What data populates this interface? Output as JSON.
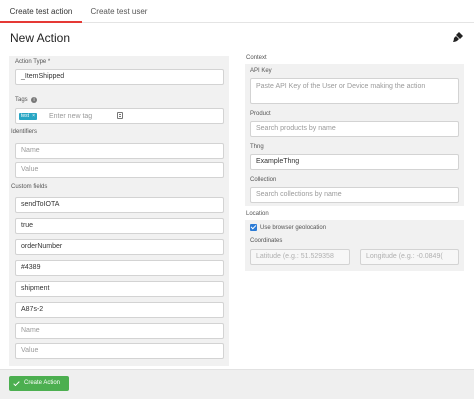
{
  "tabs": [
    {
      "label": "Create test action",
      "active": true
    },
    {
      "label": "Create test user",
      "active": false
    }
  ],
  "page_title": "New Action",
  "icons": {
    "clear": "paint-brush-icon",
    "info": "info-icon",
    "keyboard": "keyboard-icon",
    "check": "check-icon"
  },
  "colors": {
    "tab_active": "#e53935",
    "tag": "#28a6c4",
    "checkbox": "#2b7bd6",
    "button": "#4caf50"
  },
  "left": {
    "action_type": {
      "label": "Action Type *",
      "value": "_ItemShipped"
    },
    "tags": {
      "label": "Tags",
      "chip": "test",
      "chip_remove": "×",
      "placeholder": "Enter new tag"
    },
    "identifiers": {
      "label": "Identifiers",
      "name_placeholder": "Name",
      "value_placeholder": "Value"
    },
    "custom_fields": {
      "label": "Custom fields",
      "items": [
        "sendToIOTA",
        "true",
        "orderNumber",
        "#4389",
        "shipment",
        "A87s-2"
      ],
      "name_placeholder": "Name",
      "value_placeholder": "Value"
    }
  },
  "right": {
    "context_label": "Context",
    "api_key": {
      "label": "API Key",
      "placeholder": "Paste API Key of the User or Device making the action"
    },
    "product": {
      "label": "Product",
      "placeholder": "Search products by name"
    },
    "thng": {
      "label": "Thng",
      "value": "ExampleThng"
    },
    "collection": {
      "label": "Collection",
      "placeholder": "Search collections by name"
    },
    "location": {
      "label": "Location",
      "use_browser": {
        "label": "Use browser geolocation",
        "checked": true
      },
      "coordinates_label": "Coordinates",
      "latitude": "Latitude (e.g.: 51.529358",
      "longitude": "Longitude (e.g.: -0.0849("
    }
  },
  "footer": {
    "create_button": "Create Action"
  }
}
